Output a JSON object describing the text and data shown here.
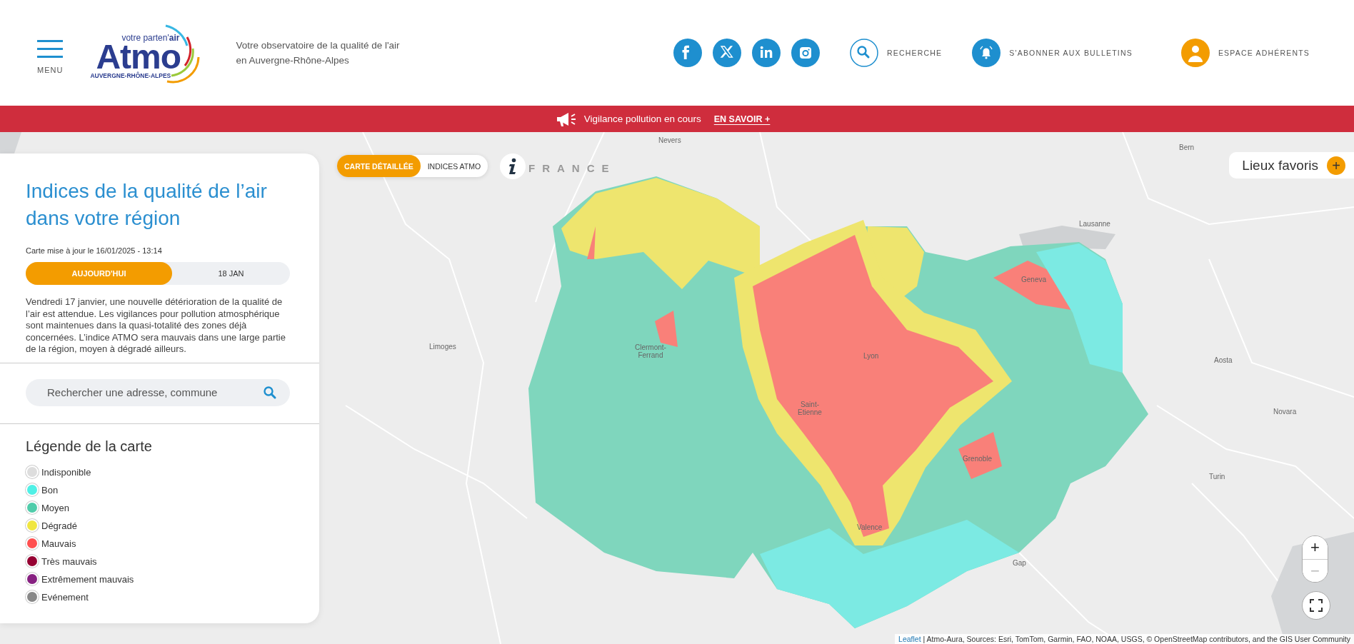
{
  "header": {
    "menu_label": "MENU",
    "logo": {
      "tagline": "votre parten'**air**",
      "name": "Atmo",
      "region": "AUVERGNE-RHÔNE-ALPES"
    },
    "description": "Votre observatoire de la qualité de l'air\nen Auvergne-Rhône-Alpes",
    "social_links": [
      {
        "kind": "facebook"
      },
      {
        "kind": "x"
      },
      {
        "kind": "linkedin"
      },
      {
        "kind": "instagram"
      }
    ],
    "actions": [
      {
        "kind": "search",
        "label": "RECHERCHE"
      },
      {
        "kind": "bell",
        "label": "S'ABONNER AUX BULLETINS"
      },
      {
        "kind": "user",
        "label": "ESPACE ADHÉRENTS"
      }
    ]
  },
  "alert_banner": {
    "text": "Vigilance pollution en cours",
    "link": "EN SAVOIR +"
  },
  "panel": {
    "title": "Indices de la qualité de l’air dans votre région",
    "updated": "Carte mise à jour le 16/01/2025 - 13:14",
    "day_tabs": [
      {
        "label": "AUJOURD'HUI",
        "selected": true
      },
      {
        "label": "18 JAN",
        "selected": false
      }
    ],
    "forecast": "Vendredi 17 janvier, une nouvelle détérioration de la qualité de l’air est attendue. Les vigilances pour pollution atmosphérique sont maintenues dans la quasi-totalité des zones déjà concernées. L’indice ATMO sera mauvais dans une large partie de la région, moyen à dégradé ailleurs.",
    "search": {
      "placeholder": "Rechercher une adresse, commune"
    },
    "legend": {
      "title": "Légende de la carte",
      "items": [
        {
          "label": "Indisponible",
          "color": "#dddddd"
        },
        {
          "label": "Bon",
          "color": "#50f0e6"
        },
        {
          "label": "Moyen",
          "color": "#50ccaa"
        },
        {
          "label": "Dégradé",
          "color": "#f0e641"
        },
        {
          "label": "Mauvais",
          "color": "#ff5050"
        },
        {
          "label": "Très mauvais",
          "color": "#960032"
        },
        {
          "label": "Extrêmement mauvais",
          "color": "#872181"
        },
        {
          "label": "Evénement",
          "color": "#888888"
        }
      ]
    }
  },
  "map": {
    "layer_toggle": [
      {
        "label": "CARTE DÉTAILLÉE",
        "selected": true
      },
      {
        "label": "INDICES ATMO",
        "selected": false
      }
    ],
    "favorites": {
      "label": "Lieux favoris",
      "button": "+"
    },
    "country_label": "FRANCE",
    "place_labels": [
      "Nevers",
      "Bern",
      "Lausanne",
      "Geneva",
      "Limoges",
      "Clermont-\nFerrand",
      "Lyon",
      "Saint-\nEtienne",
      "Grenoble",
      "Valence",
      "Aosta",
      "Novara",
      "Turin",
      "Gap"
    ],
    "zoom": {
      "in": "+",
      "out": "−",
      "out_disabled": true
    },
    "attribution": {
      "link": "Leaflet",
      "text": "| Atmo-Aura, Sources: Esri, TomTom, Garmin, FAO, NOAA, USGS, © OpenStreetMap contributors, and the GIS User Community"
    }
  }
}
